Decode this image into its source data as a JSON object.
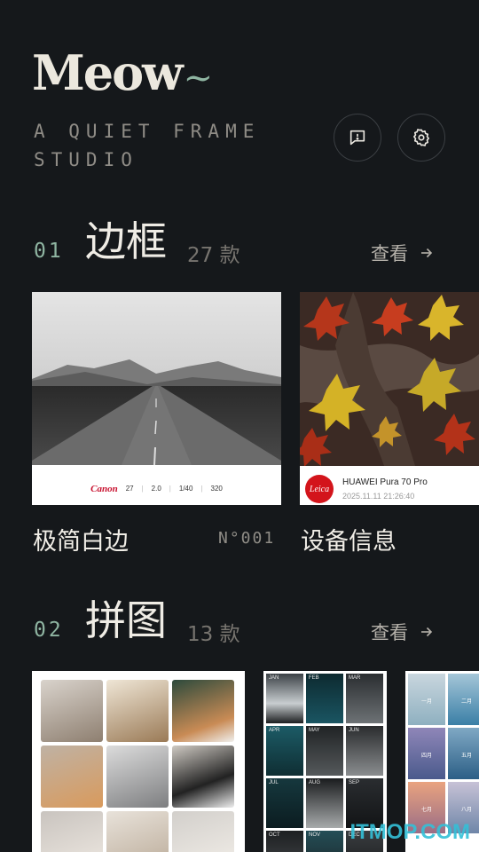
{
  "header": {
    "logo": "Meow",
    "logo_tilde": "~",
    "tagline_line1": "A QUIET FRAME",
    "tagline_line2": "STUDIO",
    "feedback_icon": "feedback-icon",
    "settings_icon": "gear-icon"
  },
  "sections": [
    {
      "number": "01",
      "title": "边框",
      "count": "27 款",
      "view_label": "查看",
      "cards": [
        {
          "label": "极简白边",
          "code": "N°001",
          "exif": {
            "brand": "Canon",
            "focal": "27",
            "aperture": "2.0",
            "shutter": "1/40",
            "iso": "320"
          }
        },
        {
          "label": "设备信息",
          "device": {
            "brand_mark": "Leica",
            "model": "HUAWEI Pura 70 Pro",
            "datetime": "2025.11.11 21:26:40"
          }
        }
      ]
    },
    {
      "number": "02",
      "title": "拼图",
      "count": "13 款",
      "view_label": "查看",
      "collages": {
        "months": [
          "JAN",
          "FEB",
          "MAR",
          "APR",
          "MAY",
          "JUN",
          "JUL",
          "AUG",
          "SEP",
          "OCT",
          "NOV",
          "DEC"
        ],
        "sea_labels": [
          "一月",
          "二月",
          "四月",
          "五月",
          "七月",
          "八月"
        ]
      }
    }
  ],
  "watermark": "ITMOP.COM",
  "colors": {
    "background": "#15181b",
    "accent": "#8fb5a2",
    "canon_red": "#c8102e",
    "leica_red": "#d3141b"
  }
}
